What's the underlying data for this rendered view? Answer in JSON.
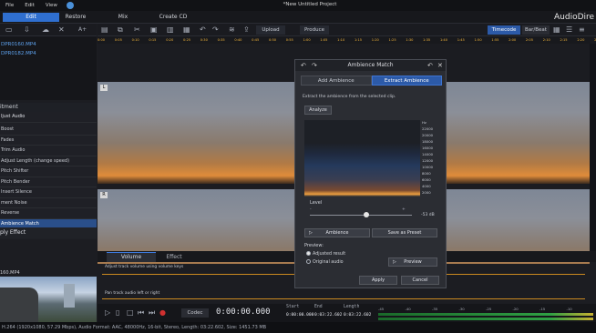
{
  "menubar": {
    "items": [
      "File",
      "Edit",
      "View"
    ],
    "title": "*New Untitled Project"
  },
  "modes": {
    "edit": "Edit",
    "restore": "Restore",
    "mix": "Mix",
    "create": "Create CD"
  },
  "brand": "AudioDire",
  "toolbar": {
    "upload": "Upload",
    "produce": "Produce",
    "timecode": "Timecode",
    "barbeat": "Bar/Beat"
  },
  "library": {
    "items": [
      "DPR0160.MP4",
      "DPR0182.MP4"
    ]
  },
  "effects": {
    "header": "itment",
    "category": "ljust Audio",
    "items": [
      "Boost",
      "Fades",
      "Trim Audio",
      "Adjust Length (change speed)",
      "Pitch Shifter",
      "Pitch Bender",
      "Insert Silence",
      "ment Noise",
      "Reverse",
      "Ambience Match"
    ],
    "apply": "ply Effect"
  },
  "video": {
    "name": "160.MP4"
  },
  "ruler": [
    "0:00",
    "0:05",
    "0:10",
    "0:15",
    "0:20",
    "0:25",
    "0:30",
    "0:35",
    "0:40",
    "0:45",
    "0:50",
    "0:55",
    "1:00",
    "1:05",
    "1:10",
    "1:15",
    "1:20",
    "1:25",
    "1:30",
    "1:35",
    "1:40",
    "1:45",
    "1:50",
    "1:55",
    "2:00",
    "2:05",
    "2:10",
    "2:15",
    "2:20",
    "2:25",
    "2:30"
  ],
  "tabs": {
    "volume": "Volume",
    "effect": "Effect"
  },
  "keys": {
    "volume_hint": "Adjust track volume using volume keys",
    "pan_hint": "Pan track audio left or right"
  },
  "transport": {
    "codec": "Codec",
    "time": "0:00:00.000",
    "start_label": "Start",
    "end_label": "End",
    "length_label": "Length",
    "start": "0:00:00.000",
    "end": "0:03:22.602",
    "length": "0:03:22.602",
    "meter_marks": [
      "-45",
      "-40",
      "-35",
      "-30",
      "-25",
      "-20",
      "-15",
      "-10"
    ]
  },
  "status": "H.264 (1920x1080, 57.29 Mbps), Audio Format: AAC, 48000Hz, 16-bit, Stereo, Length: 03:22.602, Size: 1451.73 MB",
  "dialog": {
    "title": "Ambience Match",
    "tabs": [
      "Add Ambience",
      "Extract Ambience"
    ],
    "description": "Extract the ambience from the selected clip.",
    "analyze": "Analyze",
    "freq_axis": [
      "Hz",
      "22000",
      "20000",
      "18000",
      "16000",
      "14000",
      "12000",
      "10000",
      "8000",
      "6000",
      "4000",
      "2000"
    ],
    "level_label": "Level",
    "level_min": "-",
    "level_max": "+",
    "level_db": "-53 dB",
    "level_value": 0.55,
    "ambience_btn": "Ambience",
    "save_preset": "Save as Preset",
    "preview_label": "Preview:",
    "radio_adjusted": "Adjusted result",
    "radio_original": "Original audio",
    "preview_btn": "Preview",
    "apply": "Apply",
    "cancel": "Cancel"
  }
}
